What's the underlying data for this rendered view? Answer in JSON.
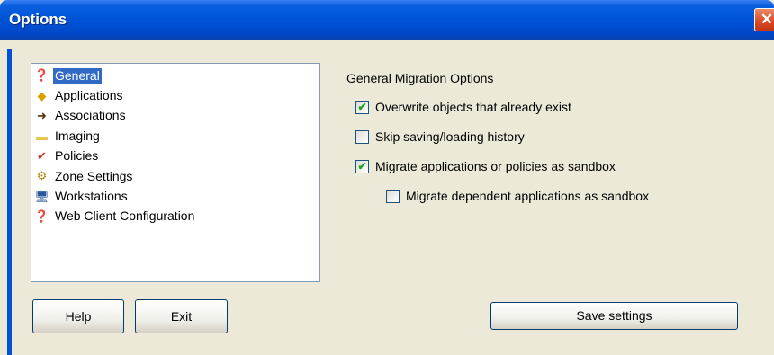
{
  "window": {
    "title": "Options",
    "close_glyph": "✕"
  },
  "sidebar": {
    "items": [
      {
        "label": "General",
        "icon": "general-icon",
        "glyph": "❓",
        "color": "#8b1d1d",
        "selected": true
      },
      {
        "label": "Applications",
        "icon": "applications-icon",
        "glyph": "◆",
        "color": "#d9a000",
        "selected": false
      },
      {
        "label": "Associations",
        "icon": "associations-icon",
        "glyph": "➜",
        "color": "#5a2e0a",
        "selected": false
      },
      {
        "label": "Imaging",
        "icon": "folder-icon",
        "glyph": "▬",
        "color": "#e6c74a",
        "selected": false
      },
      {
        "label": "Policies",
        "icon": "policies-icon",
        "glyph": "✔",
        "color": "#c0392b",
        "selected": false
      },
      {
        "label": "Zone Settings",
        "icon": "zone-settings-icon",
        "glyph": "⚙",
        "color": "#b8860b",
        "selected": false
      },
      {
        "label": "Workstations",
        "icon": "workstation-icon",
        "glyph": "🖥",
        "color": "#2b5a9c",
        "selected": false
      },
      {
        "label": "Web Client Configuration",
        "icon": "web-client-icon",
        "glyph": "❓",
        "color": "#8b1d1d",
        "selected": false
      }
    ]
  },
  "main": {
    "section_title": "General Migration Options",
    "options": [
      {
        "label": "Overwrite objects that already exist",
        "checked": true
      },
      {
        "label": "Skip saving/loading history",
        "checked": false
      },
      {
        "label": "Migrate applications or policies as sandbox",
        "checked": true
      },
      {
        "label": "Migrate dependent applications as sandbox",
        "checked": false
      }
    ]
  },
  "buttons": {
    "help": "Help",
    "exit": "Exit",
    "save": "Save settings"
  }
}
